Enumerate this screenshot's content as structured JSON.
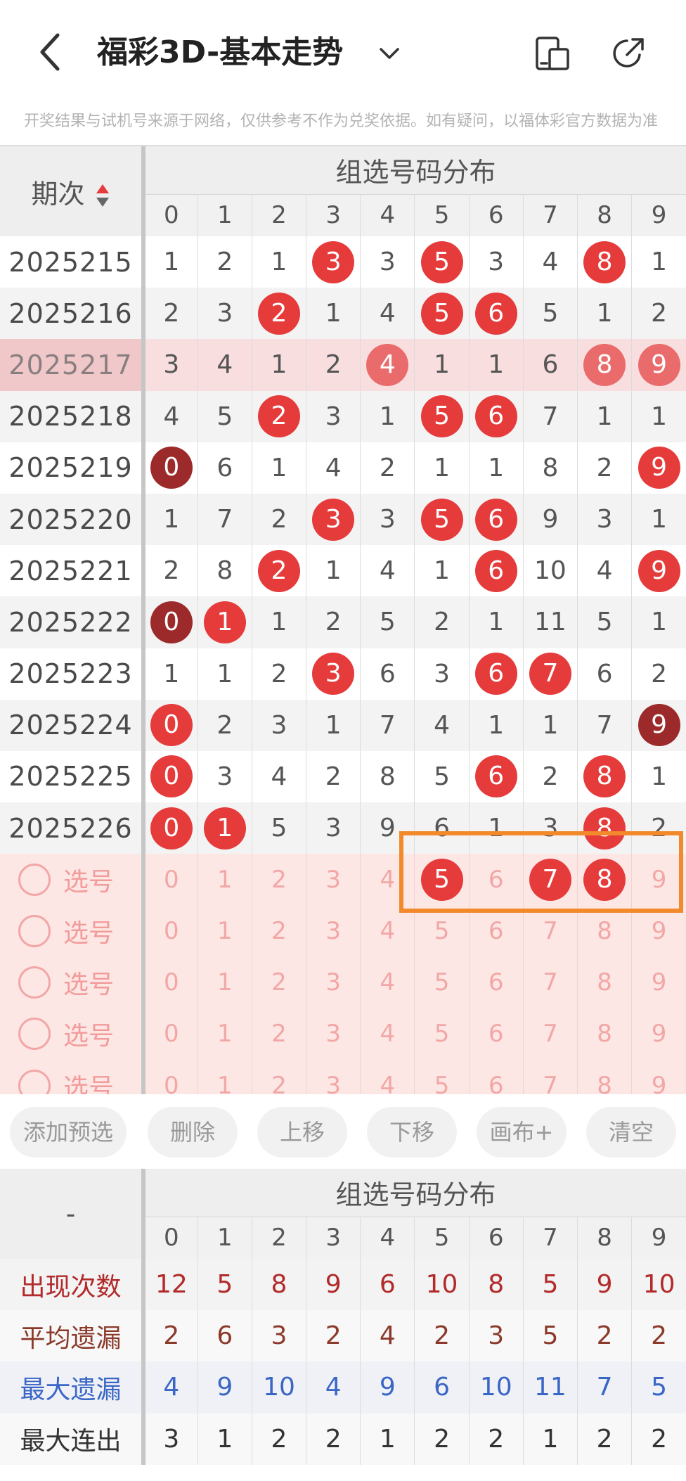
{
  "header": {
    "title": "福彩3D-基本走势",
    "disclaimer": "开奖结果与试机号来源于网络，仅供参考不作为兑奖依据。如有疑问，以福体彩官方数据为准"
  },
  "table_header": {
    "issue_label": "期次",
    "group_label": "组选号码分布",
    "digits": [
      "0",
      "1",
      "2",
      "3",
      "4",
      "5",
      "6",
      "7",
      "8",
      "9"
    ]
  },
  "rows": [
    {
      "issue": "2025215",
      "cells": [
        "1",
        "2",
        "1",
        "3",
        "3",
        "5",
        "3",
        "4",
        "8",
        "1"
      ],
      "balls": [
        3,
        5,
        8
      ],
      "dark": []
    },
    {
      "issue": "2025216",
      "cells": [
        "2",
        "3",
        "2",
        "1",
        "4",
        "5",
        "6",
        "5",
        "1",
        "2"
      ],
      "balls": [
        2,
        5,
        6
      ],
      "dark": []
    },
    {
      "issue": "2025217",
      "cells": [
        "3",
        "4",
        "1",
        "2",
        "4",
        "1",
        "1",
        "6",
        "8",
        "9"
      ],
      "balls": [
        4,
        8,
        9
      ],
      "dark": []
    },
    {
      "issue": "2025218",
      "cells": [
        "4",
        "5",
        "2",
        "3",
        "1",
        "5",
        "6",
        "7",
        "1",
        "1"
      ],
      "balls": [
        2,
        5,
        6
      ],
      "dark": []
    },
    {
      "issue": "2025219",
      "cells": [
        "0",
        "6",
        "1",
        "4",
        "2",
        "1",
        "1",
        "8",
        "2",
        "9"
      ],
      "balls": [
        0,
        9
      ],
      "dark": [
        0
      ]
    },
    {
      "issue": "2025220",
      "cells": [
        "1",
        "7",
        "2",
        "3",
        "3",
        "5",
        "6",
        "9",
        "3",
        "1"
      ],
      "balls": [
        3,
        5,
        6
      ],
      "dark": []
    },
    {
      "issue": "2025221",
      "cells": [
        "2",
        "8",
        "2",
        "1",
        "4",
        "1",
        "6",
        "10",
        "4",
        "9"
      ],
      "balls": [
        2,
        6,
        9
      ],
      "dark": []
    },
    {
      "issue": "2025222",
      "cells": [
        "0",
        "1",
        "1",
        "2",
        "5",
        "2",
        "1",
        "11",
        "5",
        "1"
      ],
      "balls": [
        0,
        1
      ],
      "dark": [
        0
      ]
    },
    {
      "issue": "2025223",
      "cells": [
        "1",
        "1",
        "2",
        "3",
        "6",
        "3",
        "6",
        "7",
        "6",
        "2"
      ],
      "balls": [
        3,
        6,
        7
      ],
      "dark": []
    },
    {
      "issue": "2025224",
      "cells": [
        "0",
        "2",
        "3",
        "1",
        "7",
        "4",
        "1",
        "1",
        "7",
        "9"
      ],
      "balls": [
        0,
        9
      ],
      "dark": [
        9
      ]
    },
    {
      "issue": "2025225",
      "cells": [
        "0",
        "3",
        "4",
        "2",
        "8",
        "5",
        "6",
        "2",
        "8",
        "1"
      ],
      "balls": [
        0,
        6,
        8
      ],
      "dark": []
    },
    {
      "issue": "2025226",
      "cells": [
        "0",
        "1",
        "5",
        "3",
        "9",
        "6",
        "1",
        "3",
        "8",
        "2"
      ],
      "balls": [
        0,
        1,
        8
      ],
      "dark": []
    }
  ],
  "pick_rows": {
    "label": "选号",
    "count": 5,
    "selected_first_row": [
      5,
      7,
      8
    ]
  },
  "actions": [
    "添加预选",
    "删除",
    "上移",
    "下移",
    "画布+",
    "清空"
  ],
  "stats_header": {
    "dash": "-",
    "group_label": "组选号码分布"
  },
  "stats": [
    {
      "label": "出现次数",
      "values": [
        "12",
        "5",
        "8",
        "9",
        "6",
        "10",
        "8",
        "5",
        "9",
        "10"
      ]
    },
    {
      "label": "平均遗漏",
      "values": [
        "2",
        "6",
        "3",
        "2",
        "4",
        "2",
        "3",
        "5",
        "2",
        "2"
      ]
    },
    {
      "label": "最大遗漏",
      "values": [
        "4",
        "9",
        "10",
        "4",
        "9",
        "6",
        "10",
        "11",
        "7",
        "5"
      ]
    },
    {
      "label": "最大连出",
      "values": [
        "3",
        "1",
        "2",
        "2",
        "1",
        "2",
        "2",
        "1",
        "2",
        "2"
      ]
    }
  ],
  "colors": {
    "ball": "#e63b3b",
    "ball_dark": "#9c2a2a",
    "highlight": "#f28a2c",
    "stat_blue": "#3a66c6"
  }
}
